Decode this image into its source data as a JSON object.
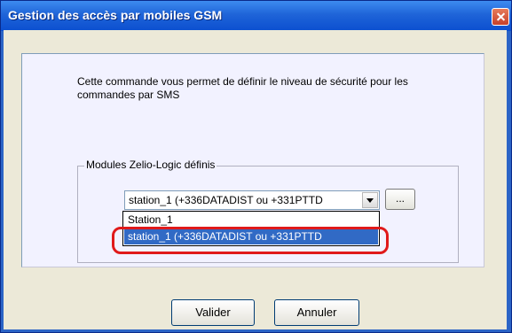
{
  "window": {
    "title": "Gestion des accès par mobiles GSM"
  },
  "dialog": {
    "description": "Cette commande vous permet de définir le niveau de sécurité pour les commandes par SMS",
    "group_label": "Modules Zelio-Logic définis",
    "combo_value": "station_1  (+336DATADIST ou +331PTTD",
    "browse_label": "...",
    "dropdown_items": [
      "Station_1",
      "station_1  (+336DATADIST ou +331PTTD"
    ],
    "selected_index": 1,
    "ok_label": "Valider",
    "cancel_label": "Annuler"
  },
  "colors": {
    "titlebar": "#0b4fd0",
    "selection": "#316ac5",
    "highlight_ring": "#e01a1a"
  }
}
